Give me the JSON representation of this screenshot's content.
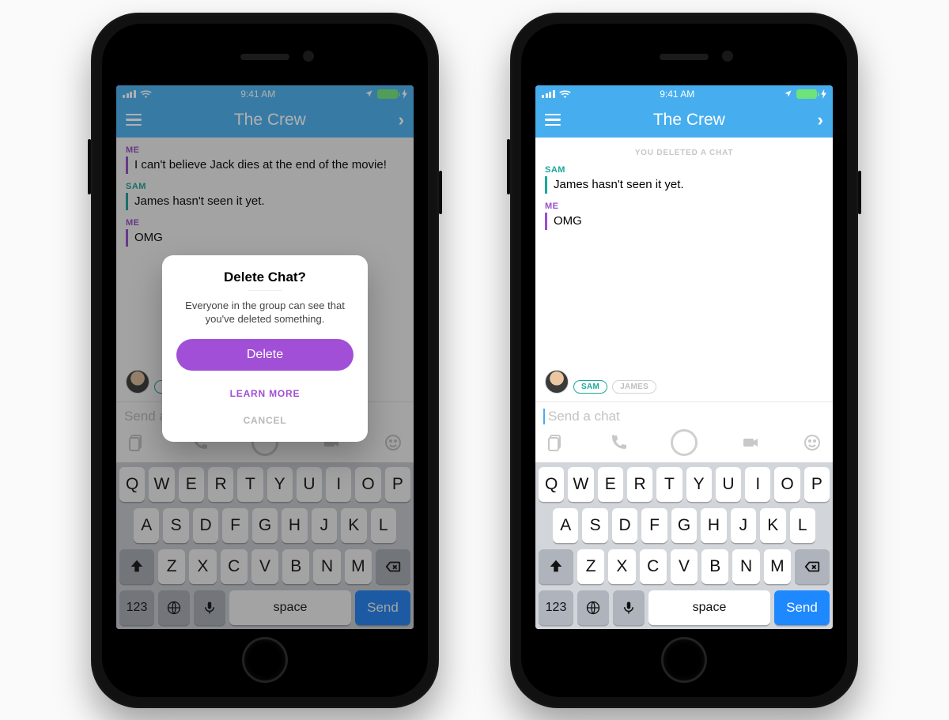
{
  "status": {
    "time": "9:41 AM"
  },
  "nav": {
    "title": "The Crew"
  },
  "chat_left": {
    "messages": [
      {
        "sender_label": "ME",
        "sender_class": "me",
        "text": "I can't believe Jack dies at the end of the movie!"
      },
      {
        "sender_label": "SAM",
        "sender_class": "sam",
        "text": "James hasn't seen it yet."
      },
      {
        "sender_label": "ME",
        "sender_class": "me",
        "text": "OMG"
      }
    ],
    "presence": [
      {
        "label": "SAM",
        "cls": "sam"
      }
    ],
    "compose_placeholder": "Send a chat"
  },
  "chat_right": {
    "system": "YOU DELETED A CHAT",
    "messages": [
      {
        "sender_label": "SAM",
        "sender_class": "sam",
        "text": "James hasn't seen it yet."
      },
      {
        "sender_label": "ME",
        "sender_class": "me",
        "text": "OMG"
      }
    ],
    "presence": [
      {
        "label": "SAM",
        "cls": "sam"
      },
      {
        "label": "JAMES",
        "cls": "james"
      }
    ],
    "compose_placeholder": "Send a chat"
  },
  "modal": {
    "title": "Delete Chat?",
    "body": "Everyone in the group can see that you've deleted something.",
    "delete": "Delete",
    "learn": "LEARN MORE",
    "cancel": "CANCEL"
  },
  "keyboard": {
    "row1": [
      "Q",
      "W",
      "E",
      "R",
      "T",
      "Y",
      "U",
      "I",
      "O",
      "P"
    ],
    "row2": [
      "A",
      "S",
      "D",
      "F",
      "G",
      "H",
      "J",
      "K",
      "L"
    ],
    "row3": [
      "Z",
      "X",
      "C",
      "V",
      "B",
      "N",
      "M"
    ],
    "num": "123",
    "space": "space",
    "send": "Send"
  }
}
